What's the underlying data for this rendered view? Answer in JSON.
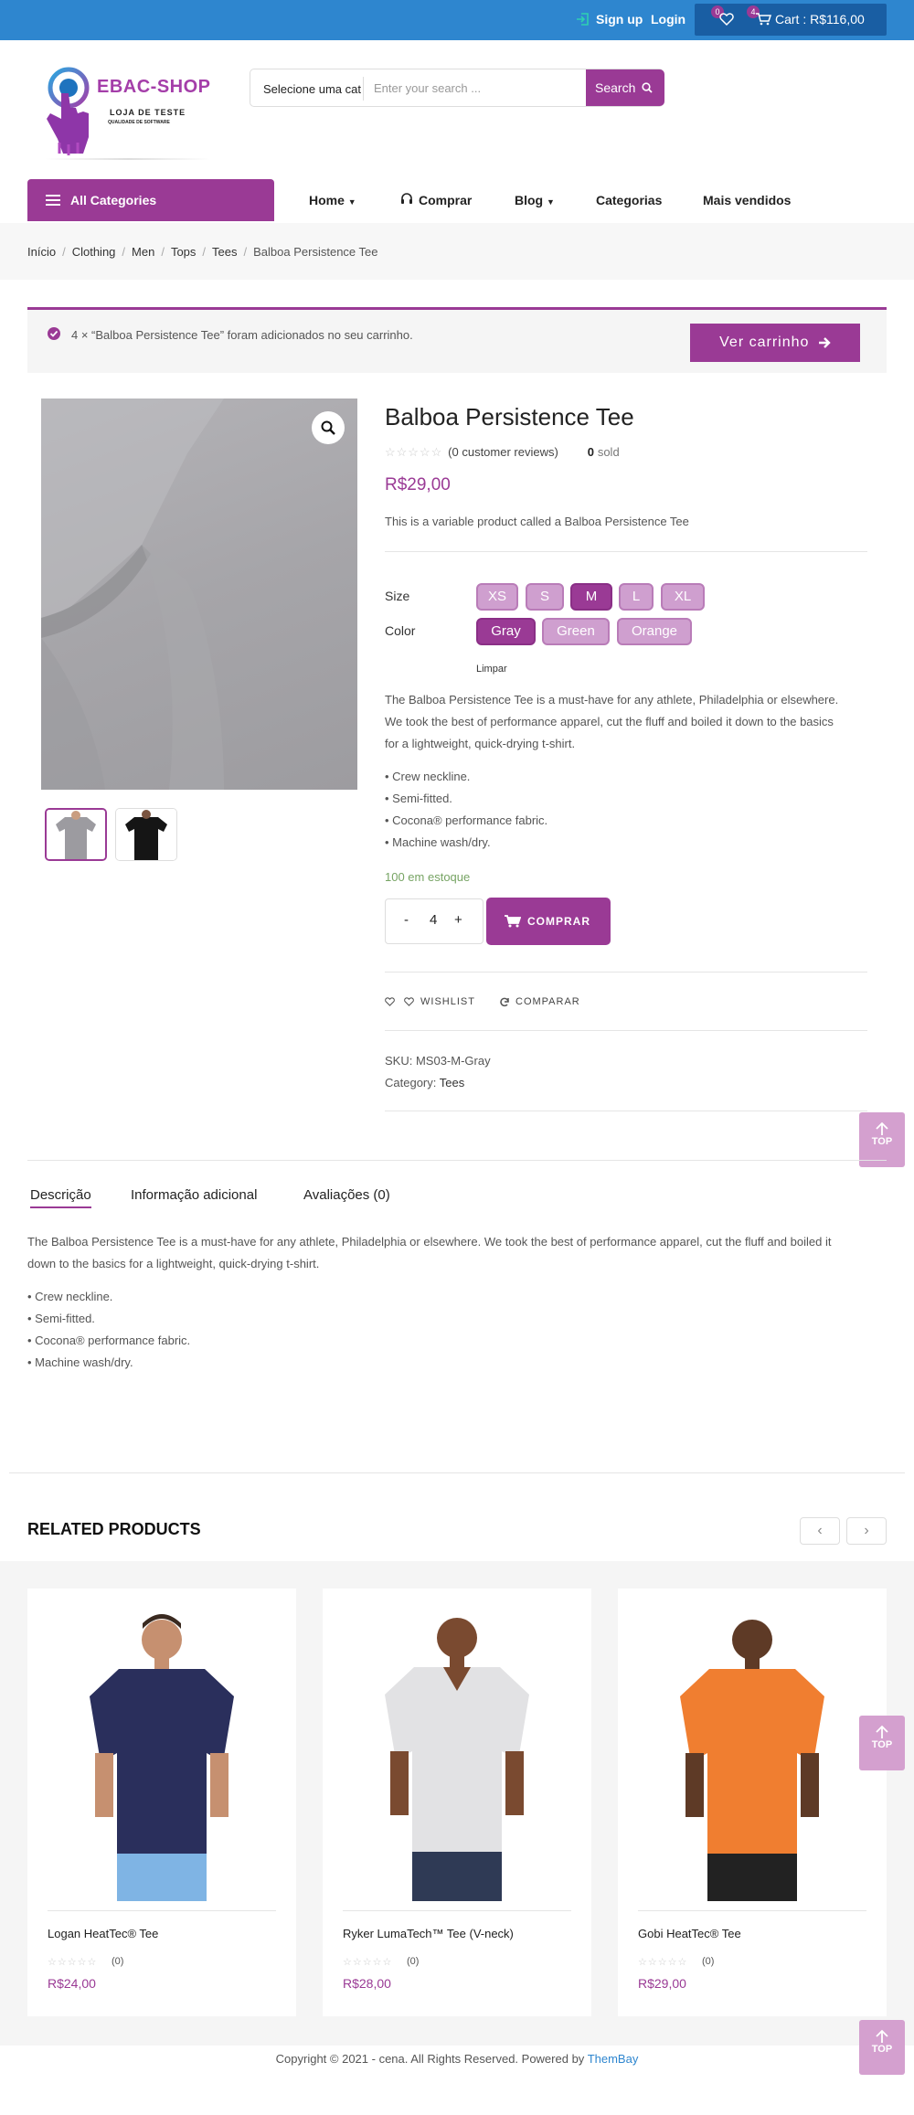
{
  "topbar": {
    "signup": "Sign up",
    "login": "Login",
    "wishlist_count": "0",
    "cart_count": "4",
    "cart_label": "Cart : R$116,00"
  },
  "logo": {
    "title": "EBAC-SHOP",
    "subtitle": "LOJA DE TESTE",
    "tagline": "QUALIDADE DE SOFTWARE"
  },
  "search": {
    "category": "Selecione uma cat",
    "placeholder": "Enter your search ...",
    "button": "Search"
  },
  "nav": {
    "all_categories": "All Categories",
    "items": [
      "Home",
      "Comprar",
      "Blog",
      "Categorias",
      "Mais vendidos"
    ]
  },
  "breadcrumb": [
    "Início",
    "Clothing",
    "Men",
    "Tops",
    "Tees",
    "Balboa Persistence Tee"
  ],
  "notice": {
    "text": "4 × “Balboa Persistence Tee” foram adicionados no seu carrinho.",
    "button": "Ver carrinho"
  },
  "product": {
    "title": "Balboa Persistence Tee",
    "reviews": "(0 customer reviews)",
    "sold_count": "0",
    "sold_label": "sold",
    "price": "R$29,00",
    "short_description": "This is a variable product called a Balboa Persistence Tee",
    "size_label": "Size",
    "sizes": [
      "XS",
      "S",
      "M",
      "L",
      "XL"
    ],
    "selected_size": "M",
    "color_label": "Color",
    "colors": [
      "Gray",
      "Green",
      "Orange"
    ],
    "selected_color": "Gray",
    "clear_label": "Limpar",
    "description": [
      "The Balboa Persistence Tee is a must-have for any athlete, Philadelphia or elsewhere.",
      "We took the best of performance apparel, cut the fluff and boiled it down to the basics",
      "for a lightweight, quick-drying t-shirt."
    ],
    "features": [
      "• Crew neckline.",
      "• Semi-fitted.",
      "• Cocona® performance fabric.",
      "• Machine wash/dry."
    ],
    "stock": "100 em estoque",
    "quantity": "4",
    "qty_minus": "-",
    "qty_plus": "+",
    "buy_button": "COMPRAR",
    "wishlist": "WISHLIST",
    "compare": "COMPARAR",
    "sku_label": "SKU:",
    "sku": "MS03-M-Gray",
    "category_label": "Category:",
    "category": "Tees"
  },
  "top_button": "TOP",
  "tabs": [
    "Descrição",
    "Informação adicional",
    "Avaliações (0)"
  ],
  "tab_content": {
    "lines": [
      "The Balboa Persistence Tee is a must-have for any athlete, Philadelphia or elsewhere. We took the best of performance apparel, cut the fluff and boiled it",
      "down to the basics for a lightweight, quick-drying t-shirt."
    ],
    "features": [
      "• Crew neckline.",
      "• Semi-fitted.",
      "• Cocona® performance fabric.",
      "• Machine wash/dry."
    ]
  },
  "related": {
    "title": "RELATED PRODUCTS",
    "products": [
      {
        "name": "Logan HeatTec® Tee",
        "count": "(0)",
        "price": "R$24,00",
        "shirt_color": "#2a2f5c",
        "pants_color": "#7fb4e4"
      },
      {
        "name": "Ryker LumaTech™ Tee (V-neck)",
        "count": "(0)",
        "price": "R$28,00",
        "shirt_color": "#e2e2e4",
        "pants_color": "#2f3a55"
      },
      {
        "name": "Gobi HeatTec® Tee",
        "count": "(0)",
        "price": "R$29,00",
        "shirt_color": "#f07e30",
        "pants_color": "#222222"
      }
    ]
  },
  "footer": {
    "text": "Copyright © 2021 - cena. All Rights Reserved. Powered by",
    "link": "ThemBay"
  },
  "colors": {
    "accent": "#9a3a95",
    "topbar": "#2e86cf",
    "cart_box": "#195ea3",
    "stock_green": "#77a464",
    "link_blue": "#2e86cf"
  }
}
